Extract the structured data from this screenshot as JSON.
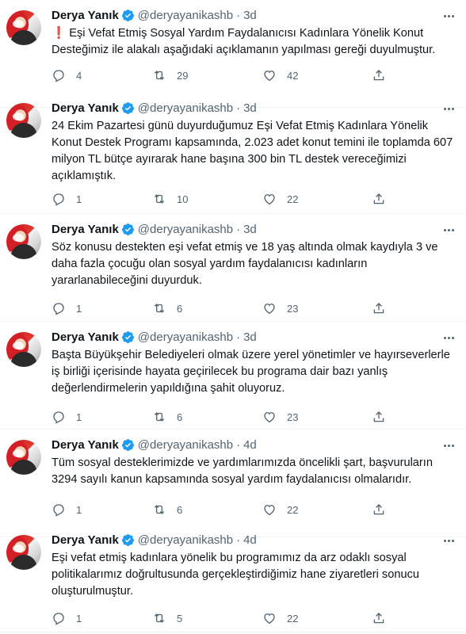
{
  "tweets": [
    {
      "author": "Derya Yanık",
      "handle": "@deryayanikashb",
      "separator": "·",
      "time": "3d",
      "alert_icon": "❗",
      "text": "Eşi Vefat Etmiş Sosyal Yardım Faydalanıcısı Kadınlara Yönelik Konut Desteğimiz ile alakalı aşağıdaki açıklamanın yapılması gereği duyulmuştur.",
      "replies": "4",
      "retweets": "29",
      "likes": "42"
    },
    {
      "author": "Derya Yanık",
      "handle": "@deryayanikashb",
      "separator": "·",
      "time": "3d",
      "text": "24 Ekim Pazartesi günü duyurduğumuz Eşi Vefat Etmiş Kadınlara Yönelik Konut Destek Programı kapsamında, 2.023 adet konut temini ile toplamda 607 milyon TL bütçe ayırarak hane başına 300 bin TL destek vereceğimizi açıklamıştık.",
      "replies": "1",
      "retweets": "10",
      "likes": "22"
    },
    {
      "author": "Derya Yanık",
      "handle": "@deryayanikashb",
      "separator": "·",
      "time": "3d",
      "text": "Söz konusu destekten eşi vefat etmiş ve 18 yaş altında olmak kaydıyla 3 ve daha fazla çocuğu olan sosyal yardım faydalanıcısı kadınların yararlanabileceğini duyurduk.",
      "replies": "1",
      "retweets": "6",
      "likes": "23"
    },
    {
      "author": "Derya Yanık",
      "handle": "@deryayanikashb",
      "separator": "·",
      "time": "3d",
      "text": "Başta Büyükşehir Belediyeleri olmak üzere yerel yönetimler ve hayırseverlerle iş birliği içerisinde hayata geçirilecek bu programa dair bazı yanlış değerlendirmelerin yapıldığına şahit oluyoruz.",
      "replies": "1",
      "retweets": "6",
      "likes": "23"
    },
    {
      "author": "Derya Yanık",
      "handle": "@deryayanikashb",
      "separator": "·",
      "time": "4d",
      "text": "Tüm sosyal desteklerimizde ve yardımlarımızda öncelikli şart, başvuruların 3294 sayılı kanun kapsamında sosyal yardım faydalanıcısı olmalarıdır.",
      "replies": "1",
      "retweets": "6",
      "likes": "22"
    },
    {
      "author": "Derya Yanık",
      "handle": "@deryayanikashb",
      "separator": "·",
      "time": "4d",
      "text": "Eşi vefat etmiş kadınlara yönelik bu programımız da arz odaklı sosyal politikalarımız doğrultusunda gerçekleştirdiğimiz hane ziyaretleri sonucu oluşturulmuştur.",
      "replies": "1",
      "retweets": "5",
      "likes": "22"
    }
  ],
  "icons": {
    "verified": "verified-badge-icon",
    "reply": "reply-icon",
    "retweet": "retweet-icon",
    "like": "heart-icon",
    "share": "share-icon",
    "more": "more-icon"
  },
  "colors": {
    "verified": "#1d9bf0",
    "secondary_text": "#536471",
    "alert": "#e0245e"
  }
}
